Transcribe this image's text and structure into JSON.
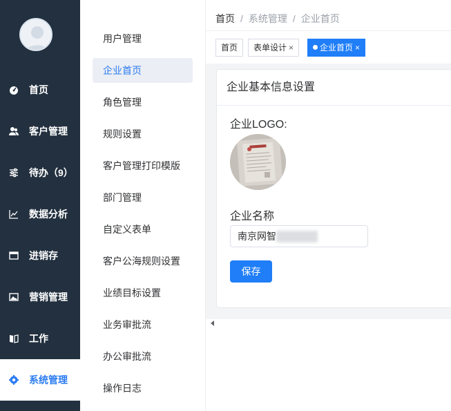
{
  "sidebar": {
    "items": [
      {
        "label": "首页",
        "icon": "dashboard-icon"
      },
      {
        "label": "客户管理",
        "icon": "users-icon"
      },
      {
        "label": "待办（9）",
        "icon": "sliders-icon"
      },
      {
        "label": "数据分析",
        "icon": "line-chart-icon"
      },
      {
        "label": "进销存",
        "icon": "window-icon"
      },
      {
        "label": "营销管理",
        "icon": "picture-icon"
      },
      {
        "label": "工作",
        "icon": "book-icon"
      },
      {
        "label": "系统管理",
        "icon": "gear-icon"
      }
    ],
    "active_index": 7
  },
  "submenu": {
    "items": [
      "用户管理",
      "企业首页",
      "角色管理",
      "规则设置",
      "客户管理打印模版",
      "部门管理",
      "自定义表单",
      "客户公海规则设置",
      "业绩目标设置",
      "业务审批流",
      "办公审批流",
      "操作日志"
    ],
    "active_index": 1
  },
  "breadcrumb": {
    "home": "首页",
    "sep": "/",
    "level1": "系统管理",
    "level2": "企业首页"
  },
  "tabs": [
    {
      "label": "首页",
      "closable": false
    },
    {
      "label": "表单设计",
      "closable": true
    },
    {
      "label": "企业首页",
      "closable": true,
      "active": true
    }
  ],
  "tab_close_glyph": "×",
  "card": {
    "title": "企业基本信息设置",
    "logo_label": "企业LOGO:",
    "name_label": "企业名称",
    "name_value": "南京网智",
    "save_label": "保存"
  },
  "colors": {
    "sidebar_bg": "#22303f",
    "accent": "#1f7ef8",
    "active_menu_bg": "#ebeef5"
  }
}
